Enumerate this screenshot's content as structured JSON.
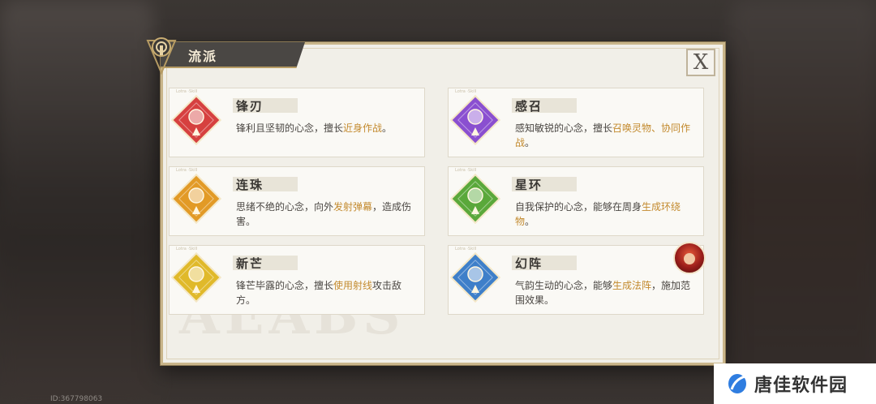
{
  "header": {
    "title": "流派"
  },
  "close_label": "X",
  "watermark": "AEABS",
  "cards": [
    {
      "id": "fengren",
      "tag": "Lotra ·Skill",
      "title": "锋刃",
      "desc_parts": [
        "锋利且坚韧的心念，擅长",
        "近身作战",
        "。"
      ],
      "color": "#d6403f"
    },
    {
      "id": "ganzhao",
      "tag": "Lotra ·Skill",
      "title": "感召",
      "desc_parts": [
        "感知敏锐的心念，擅长",
        "召唤灵物、协同作战",
        "。"
      ],
      "color": "#8a4fd0"
    },
    {
      "id": "lianzhu",
      "tag": "Lotra ·Skill",
      "title": "连珠",
      "desc_parts": [
        "思绪不绝的心念，向外",
        "发射弹幕",
        "，造成伤害。"
      ],
      "color": "#e29a26"
    },
    {
      "id": "xinghuan",
      "tag": "Lotra ·Skill",
      "title": "星环",
      "desc_parts": [
        "自我保护的心念，能够在周身",
        "生成环绕物",
        "。"
      ],
      "color": "#5aa83a"
    },
    {
      "id": "xinmang",
      "tag": "Lotra ·Skill",
      "title": "新芒",
      "desc_parts": [
        "锋芒毕露的心念，擅长",
        "使用射线",
        "攻击敌方。"
      ],
      "color": "#e0b92a"
    },
    {
      "id": "huanzhen",
      "tag": "Lotra ·Skill",
      "title": "幻阵",
      "desc_parts": [
        "气韵生动的心念，能够",
        "生成法阵",
        "，施加范围效果。"
      ],
      "color": "#3e7fc9"
    }
  ],
  "footer": {
    "id_text": "ID:367798063"
  },
  "brand": {
    "text": "唐佳软件园"
  },
  "colors": {
    "highlight": "#c38a2e",
    "panel_border": "#c9b58a"
  }
}
